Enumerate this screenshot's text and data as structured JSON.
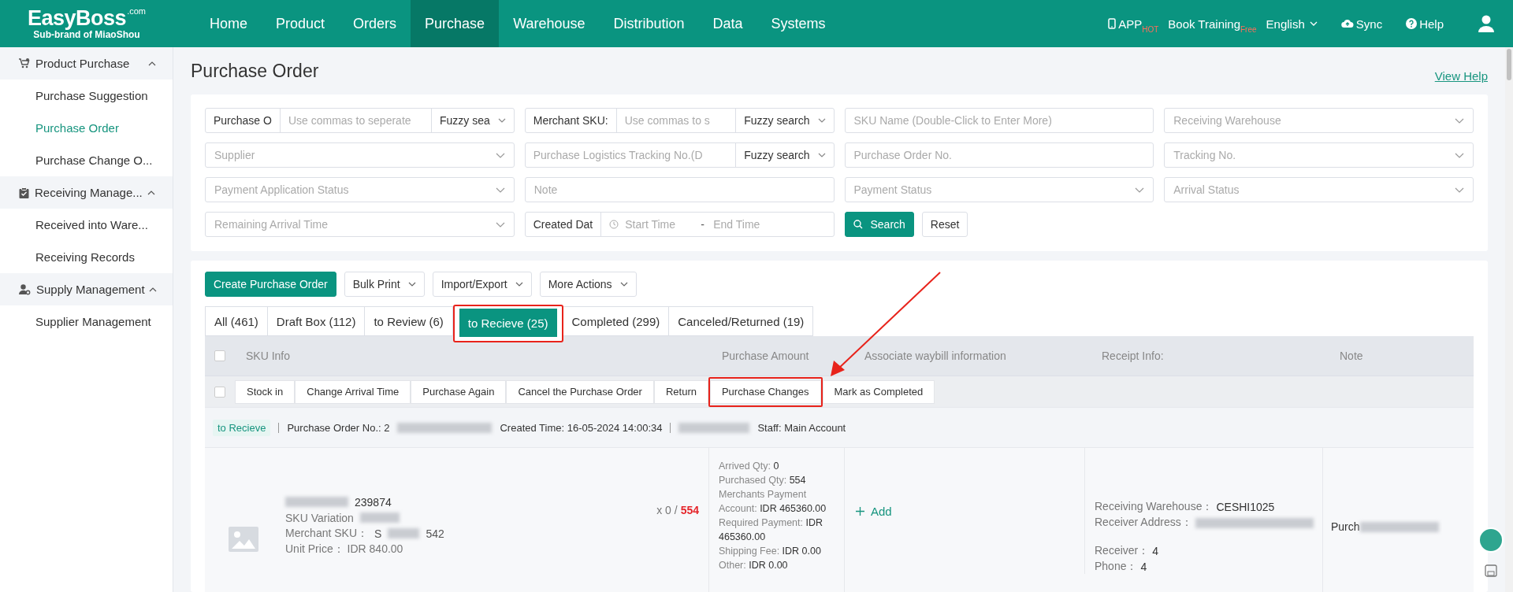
{
  "header": {
    "logo": "EasyBoss",
    "logo_suffix": ".com",
    "tagline": "Sub-brand of MiaoShou",
    "nav": [
      {
        "label": "Home",
        "selected": false
      },
      {
        "label": "Product",
        "selected": false
      },
      {
        "label": "Orders",
        "selected": false
      },
      {
        "label": "Purchase",
        "selected": true
      },
      {
        "label": "Warehouse",
        "selected": false
      },
      {
        "label": "Distribution",
        "selected": false
      },
      {
        "label": "Data",
        "selected": false
      },
      {
        "label": "Systems",
        "selected": false
      }
    ],
    "app": {
      "label": "APP",
      "badge": "HOT"
    },
    "training": {
      "label": "Book Training",
      "badge": "Free"
    },
    "language": "English",
    "sync": "Sync",
    "help": "Help"
  },
  "sidebar": {
    "groups": [
      {
        "title": "Product Purchase",
        "expanded": true,
        "items": [
          {
            "label": "Purchase Suggestion",
            "selected": false
          },
          {
            "label": "Purchase Order",
            "selected": true
          },
          {
            "label": "Purchase Change O...",
            "selected": false
          }
        ]
      },
      {
        "title": "Receiving Manage...",
        "expanded": true,
        "items": [
          {
            "label": "Received into Ware...",
            "selected": false
          },
          {
            "label": "Receiving Records",
            "selected": false
          }
        ]
      },
      {
        "title": "Supply Management",
        "expanded": true,
        "items": [
          {
            "label": "Supplier Management",
            "selected": false
          }
        ]
      }
    ]
  },
  "page": {
    "title": "Purchase Order",
    "help_link": "View Help"
  },
  "filters": [
    {
      "kind": "combo",
      "label": "Purchase O",
      "placeholder": "Use commas to seperate",
      "mode": "Fuzzy sea"
    },
    {
      "kind": "combo",
      "label": "Merchant SKU:",
      "placeholder": "Use commas to s",
      "mode": "Fuzzy search"
    },
    {
      "kind": "input",
      "placeholder": "SKU Name (Double-Click to Enter More)"
    },
    {
      "kind": "select",
      "placeholder": "Receiving Warehouse"
    },
    {
      "kind": "select",
      "placeholder": "Supplier"
    },
    {
      "kind": "combo",
      "placeholder": "Purchase Logistics Tracking No.(D",
      "mode": "Fuzzy search"
    },
    {
      "kind": "input",
      "placeholder": "Purchase Order No."
    },
    {
      "kind": "select",
      "placeholder": "Tracking No."
    },
    {
      "kind": "select",
      "placeholder": "Payment Application Status"
    },
    {
      "kind": "input",
      "placeholder": "Note"
    },
    {
      "kind": "select",
      "placeholder": "Payment Status"
    },
    {
      "kind": "select",
      "placeholder": "Arrival Status"
    },
    {
      "kind": "select",
      "placeholder": "Remaining Arrival Time"
    },
    {
      "kind": "date",
      "label": "Created Dat",
      "start": "Start Time",
      "separator": "-",
      "end": "End Time"
    }
  ],
  "search_button": "Search",
  "reset_button": "Reset",
  "toolbar": [
    {
      "label": "Create Purchase Order",
      "kind": "primary"
    },
    {
      "label": "Bulk Print",
      "kind": "dropdown"
    },
    {
      "label": "Import/Export",
      "kind": "dropdown"
    },
    {
      "label": "More Actions",
      "kind": "dropdown"
    }
  ],
  "tabs": [
    {
      "label": "All (461)",
      "selected": false,
      "highlighted": false
    },
    {
      "label": "Draft Box (112)",
      "selected": false,
      "highlighted": false
    },
    {
      "label": "to Review (6)",
      "selected": false,
      "highlighted": false
    },
    {
      "label": "to Recieve (25)",
      "selected": true,
      "highlighted": true
    },
    {
      "label": "Completed (299)",
      "selected": false,
      "highlighted": false
    },
    {
      "label": "Canceled/Returned (19)",
      "selected": false,
      "highlighted": false
    }
  ],
  "table": {
    "columns": [
      "SKU Info",
      "Purchase Amount",
      "Associate waybill information",
      "Receipt Info:",
      "Note"
    ],
    "select_all_checked": false,
    "bulk_checked": false,
    "bulk_actions": [
      {
        "label": "Stock in",
        "highlighted": false
      },
      {
        "label": "Change Arrival Time",
        "highlighted": false
      },
      {
        "label": "Purchase Again",
        "highlighted": false
      },
      {
        "label": "Cancel the Purchase Order",
        "highlighted": false
      },
      {
        "label": "Return",
        "highlighted": false
      },
      {
        "label": "Purchase Changes",
        "highlighted": true
      },
      {
        "label": "Mark as Completed",
        "highlighted": false
      }
    ],
    "order": {
      "status": "to Recieve",
      "order_no": "Purchase Order No.: 2",
      "created": "Created Time: 16-05-2024 14:00:34",
      "staff": "Staff: Main Account",
      "sku_code": "239874",
      "variation": "SKU Variation",
      "merchant_sku_label": "Merchant SKU：",
      "merchant_sku_start": "S",
      "merchant_sku_end": "542",
      "unit_price": "Unit Price：  IDR 840.00",
      "qty_prefix": "x 0 /",
      "qty_total": "554",
      "amounts": [
        {
          "label": "Arrived Qty:",
          "value": "0"
        },
        {
          "label": "Purchased Qty:",
          "value": "554"
        },
        {
          "label": "Merchants Payment Account:",
          "value": "IDR 465360.00"
        },
        {
          "label": "Required Payment:",
          "value": "IDR 465360.00"
        },
        {
          "label": "Shipping Fee:",
          "value": "IDR 0.00"
        },
        {
          "label": "Other:",
          "value": "IDR 0.00"
        }
      ],
      "add_waybill": "Add",
      "receipt": [
        {
          "label": "Receiving Warehouse：",
          "value": "CESHI1025",
          "redacted": false
        },
        {
          "label": "Receiver Address：",
          "redacted": true
        },
        {
          "label": "Receiver：",
          "value": "4",
          "redacted": false
        },
        {
          "label": "Phone：",
          "value": "4",
          "redacted": false
        }
      ],
      "note": "Purch"
    }
  }
}
